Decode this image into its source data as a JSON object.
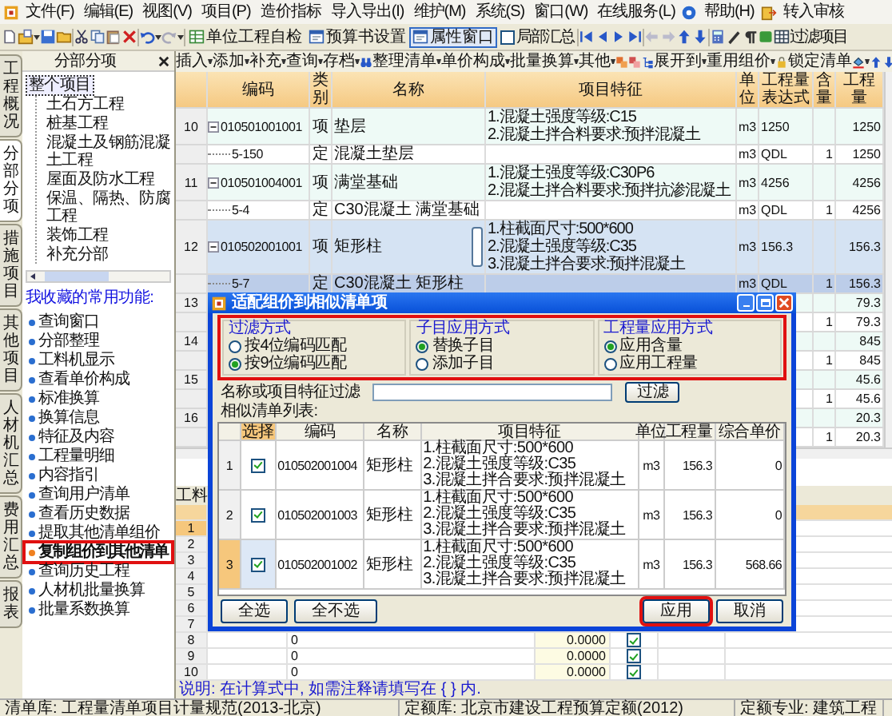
{
  "menu_bar": [
    "文件(F)",
    "编辑(E)",
    "视图(V)",
    "项目(P)",
    "造价指标",
    "导入导出(I)",
    "维护(M)",
    "系统(S)",
    "窗口(W)",
    "在线服务(L)",
    "帮助(H)",
    "转入审核"
  ],
  "toolbar": {
    "unit_check": "单位工程自检",
    "budget_settings": "预算书设置",
    "properties": {
      "label": "属性窗口",
      "selected": true
    },
    "partial_summary": {
      "label": "局部汇总",
      "checked": false
    },
    "filter": "过滤项目"
  },
  "left_tabs": [
    {
      "label": "工程概况",
      "selected": false
    },
    {
      "label": "分部分项",
      "selected": true
    },
    {
      "label": "措施项目",
      "selected": false
    },
    {
      "label": "其他项目",
      "selected": false
    },
    {
      "label": "人材机汇总",
      "selected": false
    },
    {
      "label": "费用汇总",
      "selected": false
    },
    {
      "label": "报表",
      "selected": false
    }
  ],
  "section_panel": {
    "title": "分部分项",
    "tree": {
      "label": "整个项目",
      "selected": true,
      "children": [
        {
          "label": "土石方工程"
        },
        {
          "label": "桩基工程"
        },
        {
          "label": "混凝土及钢筋混凝土工程"
        },
        {
          "label": "屋面及防水工程"
        },
        {
          "label": "保温、隔热、防腐工程"
        },
        {
          "label": "装饰工程"
        },
        {
          "label": "补充分部"
        }
      ]
    }
  },
  "favorites": {
    "title": "我收藏的常用功能:",
    "items": [
      {
        "label": "查询窗口",
        "selected": false
      },
      {
        "label": "分部整理",
        "selected": false
      },
      {
        "label": "工料机显示",
        "selected": false
      },
      {
        "label": "查看单价构成",
        "selected": false
      },
      {
        "label": "标准换算",
        "selected": false
      },
      {
        "label": "换算信息",
        "selected": false
      },
      {
        "label": "特征及内容",
        "selected": false
      },
      {
        "label": "工程量明细",
        "selected": false
      },
      {
        "label": "内容指引",
        "selected": false
      },
      {
        "label": "查询用户清单",
        "selected": false
      },
      {
        "label": "查看历史数据",
        "selected": false
      },
      {
        "label": "提取其他清单组价",
        "selected": false
      },
      {
        "label": "复制组价到其他清单",
        "selected": true,
        "highlighted": true
      },
      {
        "label": "查询历史工程",
        "selected": false
      },
      {
        "label": "人材机批量换算",
        "selected": false
      },
      {
        "label": "批量系数换算",
        "selected": false
      }
    ]
  },
  "section_toolbar": {
    "menus": [
      "插入",
      "添加",
      "补充",
      "查询",
      "存档",
      "整理清单",
      "单价构成",
      "批量换算",
      "其他"
    ],
    "expand": "展开到",
    "reuse": "重用组价",
    "lock": "锁定清单"
  },
  "main_table": {
    "columns": [
      "编码",
      "类别",
      "名称",
      "项目特征",
      "单位",
      "工程量表达式",
      "含量",
      "工程量"
    ],
    "rows": [
      {
        "kind": "item",
        "number": "10",
        "code": "010501001001",
        "type": "项",
        "name": "垫层",
        "features": [
          "1.混凝土强度等级:C15",
          "2.混凝土拌合料要求:预拌混凝土"
        ],
        "unit": "m3",
        "expression": "1250",
        "quantity": "1250",
        "selected": false
      },
      {
        "kind": "sub",
        "code": "5-150",
        "type": "定",
        "name": "混凝土垫层",
        "unit": "m3",
        "expression": "QDL",
        "content": "1",
        "quantity": "1250",
        "selected": false
      },
      {
        "kind": "item",
        "number": "11",
        "code": "010501004001",
        "type": "项",
        "name": "满堂基础",
        "features": [
          "1.混凝土强度等级:C30P6",
          "2.混凝土拌合料要求:预拌抗渗混凝土"
        ],
        "unit": "m3",
        "expression": "4256",
        "quantity": "4256",
        "selected": false
      },
      {
        "kind": "sub",
        "code": "5-4",
        "type": "定",
        "name": "C30混凝土 满堂基础",
        "unit": "m3",
        "expression": "QDL",
        "content": "1",
        "quantity": "4256",
        "selected": false
      },
      {
        "kind": "item",
        "number": "12",
        "code": "010502001001",
        "type": "项",
        "name": "矩形柱",
        "features": [
          "1.柱截面尺寸:500*600",
          "2.混凝土强度等级:C35",
          "3.混凝土拌合要求:预拌混凝土"
        ],
        "unit": "m3",
        "expression": "156.3",
        "quantity": "156.3",
        "selected": true
      },
      {
        "kind": "sub",
        "code": "5-7",
        "type": "定",
        "name": "C30混凝土 矩形柱",
        "unit": "m3",
        "expression": "QDL",
        "content": "1",
        "quantity": "156.3",
        "selected": true
      },
      {
        "kind": "item",
        "number": "13",
        "quantity": "79.3",
        "selected": false
      },
      {
        "kind": "sub",
        "content": "1",
        "quantity": "79.3",
        "selected": false
      },
      {
        "kind": "item",
        "number": "14",
        "quantity": "845",
        "selected": false
      },
      {
        "kind": "sub",
        "content": "1",
        "quantity": "845",
        "selected": false
      },
      {
        "kind": "item",
        "number": "15",
        "quantity": "45.6",
        "selected": false
      },
      {
        "kind": "sub",
        "content": "1",
        "quantity": "45.6",
        "selected": false
      },
      {
        "kind": "item",
        "number": "16",
        "quantity": "20.3",
        "selected": false
      },
      {
        "kind": "sub",
        "content": "1",
        "quantity": "20.3",
        "selected": false
      }
    ]
  },
  "lower_panel": {
    "tab": "工料",
    "rows": [
      {
        "number": "1",
        "selected": true
      },
      {
        "number": "2",
        "selected": false
      },
      {
        "number": "3",
        "selected": false
      },
      {
        "number": "4",
        "selected": false
      },
      {
        "number": "5",
        "selected": false
      },
      {
        "number": "6",
        "selected": false
      },
      {
        "number": "7",
        "selected": false
      },
      {
        "number": "8",
        "selected": false,
        "value": "0",
        "amount": "0.0000",
        "checked": true
      },
      {
        "number": "9",
        "selected": false,
        "value": "0",
        "amount": "0.0000",
        "checked": true
      },
      {
        "number": "10",
        "selected": false,
        "value": "0",
        "amount": "0.0000",
        "checked": true
      }
    ]
  },
  "note": "说明: 在计算式中, 如需注释请填写在 { } 内.",
  "dialog": {
    "title": "适配组价到相似清单项",
    "options_highlighted": true,
    "option_groups": [
      {
        "title": "过滤方式",
        "options": [
          {
            "label": "按4位编码匹配",
            "selected": false
          },
          {
            "label": "按9位编码匹配",
            "selected": true
          }
        ]
      },
      {
        "title": "子目应用方式",
        "options": [
          {
            "label": "替换子目",
            "selected": true
          },
          {
            "label": "添加子目",
            "selected": false
          }
        ]
      },
      {
        "title": "工程量应用方式",
        "options": [
          {
            "label": "应用含量",
            "selected": true
          },
          {
            "label": "应用工程量",
            "selected": false
          }
        ]
      }
    ],
    "filter_label": "名称或项目特征过滤",
    "filter_button": "过滤",
    "list_label": "相似清单列表:",
    "columns": [
      "选择",
      "编码",
      "名称",
      "项目特征",
      "单位",
      "工程量",
      "综合单价"
    ],
    "rows": [
      {
        "number": "1",
        "checked": true,
        "code": "010502001004",
        "name": "矩形柱",
        "features": [
          "1.柱截面尺寸:500*600",
          "2.混凝土强度等级:C35",
          "3.混凝土拌合要求:预拌混凝土"
        ],
        "unit": "m3",
        "quantity": "156.3",
        "price": "0",
        "selected": false
      },
      {
        "number": "2",
        "checked": true,
        "code": "010502001003",
        "name": "矩形柱",
        "features": [
          "1.柱截面尺寸:500*600",
          "2.混凝土强度等级:C35",
          "3.混凝土拌合要求:预拌混凝土"
        ],
        "unit": "m3",
        "quantity": "156.3",
        "price": "0",
        "selected": false
      },
      {
        "number": "3",
        "checked": true,
        "code": "010502001002",
        "name": "矩形柱",
        "features": [
          "1.柱截面尺寸:500*600",
          "2.混凝土强度等级:C35",
          "3.混凝土拌合要求:预拌混凝土"
        ],
        "unit": "m3",
        "quantity": "156.3",
        "price": "568.66",
        "selected": true
      }
    ],
    "buttons": [
      {
        "label": "全选",
        "highlighted": false
      },
      {
        "label": "全不选",
        "highlighted": false
      },
      {
        "label": "应用",
        "highlighted": true
      },
      {
        "label": "取消",
        "highlighted": false
      }
    ]
  },
  "status_bar": [
    "清单库: 工程量清单项目计量规范(2013-北京)",
    "定额库: 北京市建设工程预算定额(2012)",
    "定额专业: 建筑工程"
  ]
}
